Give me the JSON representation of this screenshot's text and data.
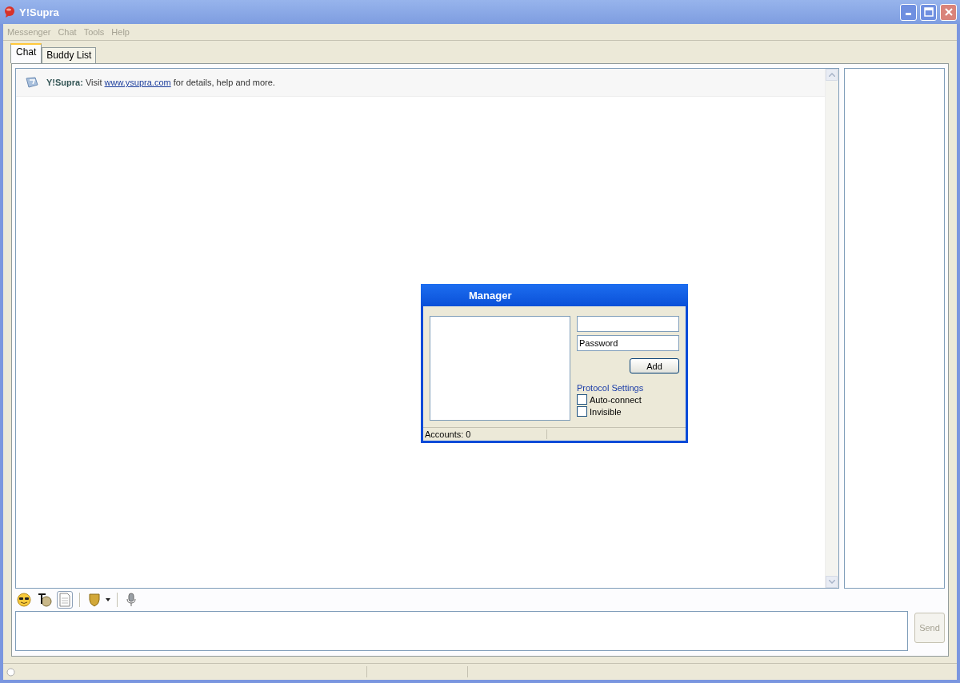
{
  "window": {
    "title": "Y!Supra"
  },
  "menu": [
    {
      "label": "Messenger"
    },
    {
      "label": "Chat"
    },
    {
      "label": "Tools"
    },
    {
      "label": "Help"
    }
  ],
  "tabs": [
    {
      "label": "Chat",
      "selected": true
    },
    {
      "label": "Buddy List",
      "selected": false
    }
  ],
  "notice": {
    "prefix": "**Y!Supra:** Visit ",
    "link": "www.ysupra.com",
    "suffix": " for details, help and more."
  },
  "send_button": {
    "label": "Send",
    "disabled": true
  },
  "dialog": {
    "title": "Manager",
    "password": {
      "value": "Password"
    },
    "add_button": "Add",
    "section": "Protocol Settings",
    "options": [
      {
        "label": "Auto-connect",
        "checked": false
      },
      {
        "label": "Invisible",
        "checked": false
      }
    ],
    "status": "Accounts: 0"
  }
}
